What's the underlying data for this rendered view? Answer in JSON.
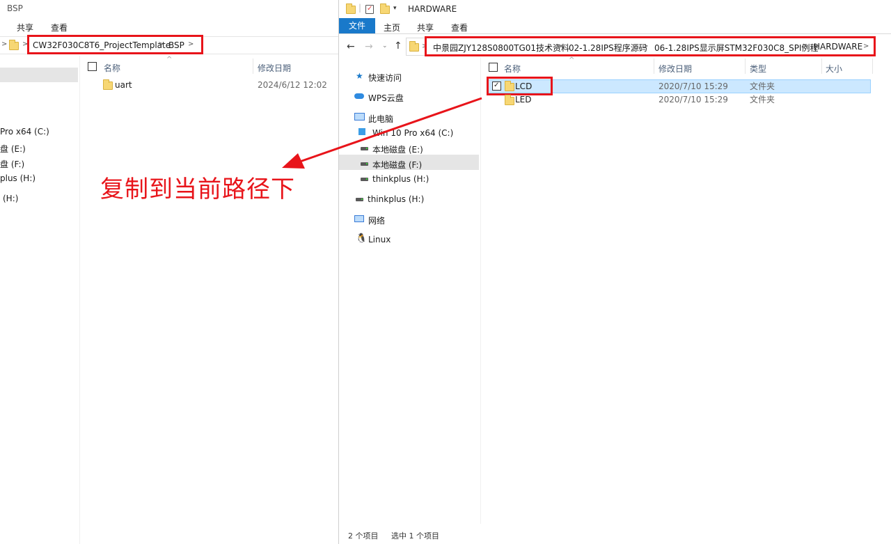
{
  "left": {
    "title": "BSP",
    "ribbon_tabs": [
      "共享",
      "查看"
    ],
    "breadcrumb": [
      "CW32F030C8T6_ProjectTemplate",
      "BSP"
    ],
    "columns": {
      "name": "名称",
      "modified": "修改日期"
    },
    "files": [
      {
        "name": "uart",
        "date": "2024/6/12 12:02"
      }
    ],
    "nav_partial": [
      "Pro x64 (C:)",
      "盘 (E:)",
      "盘 (F:)",
      "plus (H:)",
      "(H:)"
    ]
  },
  "right": {
    "title": "HARDWARE",
    "ribbon_tabs": {
      "file": "文件",
      "home": "主页",
      "share": "共享",
      "view": "查看"
    },
    "breadcrumb": [
      "中景园ZJY128S0800TG01技术资料",
      "02-1.28IPS程序源码",
      "06-1.28IPS显示屏STM32F030C8_SPI例程",
      "HARDWARE"
    ],
    "columns": {
      "name": "名称",
      "modified": "修改日期",
      "type": "类型",
      "size": "大小"
    },
    "files": [
      {
        "name": "LCD",
        "date": "2020/7/10 15:29",
        "type": "文件夹",
        "selected": true
      },
      {
        "name": "LED",
        "date": "2020/7/10 15:29",
        "type": "文件夹",
        "selected": false
      }
    ],
    "nav": {
      "quick_access": "快速访问",
      "wps_cloud": "WPS云盘",
      "this_pc": "此电脑",
      "drive_c": "Win 10 Pro x64 (C:)",
      "drive_e": "本地磁盘 (E:)",
      "drive_f": "本地磁盘 (F:)",
      "drive_h": "thinkplus (H:)",
      "thinkplus": "thinkplus (H:)",
      "network": "网络",
      "linux": "Linux"
    },
    "status": {
      "count": "2 个项目",
      "selected": "选中 1 个项目"
    }
  },
  "annotation": {
    "text": "复制到当前路径下",
    "color": "#e8141a"
  },
  "colors": {
    "accent": "#1979ca",
    "highlight": "#e8141a",
    "selection": "#cce8ff"
  }
}
